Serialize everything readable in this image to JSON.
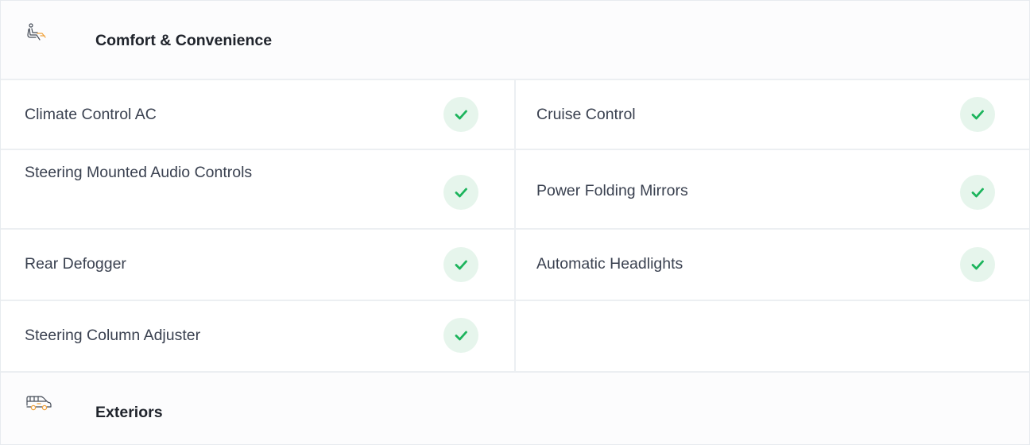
{
  "sections": [
    {
      "title": "Comfort & Convenience",
      "icon": "car-seat-icon",
      "features": [
        {
          "label": "Climate Control AC",
          "available": true
        },
        {
          "label": "Cruise Control",
          "available": true
        },
        {
          "label": "Steering Mounted Audio Controls",
          "available": true
        },
        {
          "label": "Power Folding Mirrors",
          "available": true
        },
        {
          "label": "Rear Defogger",
          "available": true
        },
        {
          "label": "Automatic Headlights",
          "available": true
        },
        {
          "label": "Steering Column Adjuster",
          "available": true
        }
      ]
    },
    {
      "title": "Exteriors",
      "icon": "car-exterior-icon"
    }
  ],
  "colors": {
    "check": "#1cb45c",
    "check_bg": "#e6f5ec",
    "icon_accent": "#f0a23b",
    "border": "#eceff2"
  }
}
